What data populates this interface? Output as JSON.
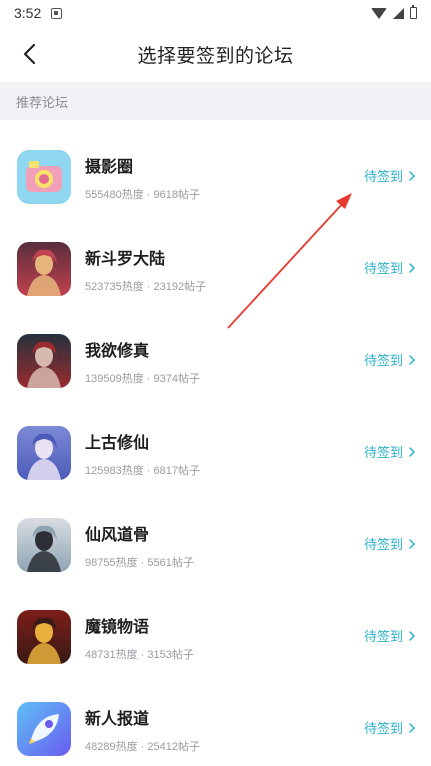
{
  "status_bar": {
    "time": "3:52"
  },
  "header": {
    "title": "选择要签到的论坛"
  },
  "section": {
    "label": "推荐论坛"
  },
  "forums": [
    {
      "name": "摄影圈",
      "heat": "555480热度",
      "posts": "9618帖子",
      "action": "待签到",
      "icon": "camera-icon",
      "colors": [
        "#8fd6f0",
        "#f2a0b8",
        "#f7e26a"
      ]
    },
    {
      "name": "新斗罗大陆",
      "heat": "523735热度",
      "posts": "23192帖子",
      "action": "待签到",
      "icon": "game-art-icon",
      "colors": [
        "#5a2d3b",
        "#e7b67c",
        "#c1414f"
      ]
    },
    {
      "name": "我欲修真",
      "heat": "139509热度",
      "posts": "9374帖子",
      "action": "待签到",
      "icon": "game-art-icon",
      "colors": [
        "#27313d",
        "#d7b9b0",
        "#9a2b2f"
      ]
    },
    {
      "name": "上古修仙",
      "heat": "125983热度",
      "posts": "6817帖子",
      "action": "待签到",
      "icon": "game-art-icon",
      "colors": [
        "#7d8ad6",
        "#e9e2f4",
        "#4c5bb8"
      ]
    },
    {
      "name": "仙风道骨",
      "heat": "98755热度",
      "posts": "5561帖子",
      "action": "待签到",
      "icon": "game-art-icon",
      "colors": [
        "#d9dde2",
        "#2c2f36",
        "#8ea4b3"
      ]
    },
    {
      "name": "魔镜物语",
      "heat": "48731热度",
      "posts": "3153帖子",
      "action": "待签到",
      "icon": "game-art-icon",
      "colors": [
        "#7d1d1a",
        "#e7b13c",
        "#3a1a14"
      ]
    },
    {
      "name": "新人报道",
      "heat": "48289热度",
      "posts": "25412帖子",
      "action": "待签到",
      "icon": "rocket-icon",
      "colors": [
        "#5ec0f5",
        "#6a5cf0",
        "#f0f7ff"
      ]
    }
  ],
  "stats_separator": " · ",
  "accent_color": "#2bb1c9",
  "annotation": {
    "type": "red-arrow-pointing-to-first-checkin",
    "color": "#e63a2e"
  }
}
